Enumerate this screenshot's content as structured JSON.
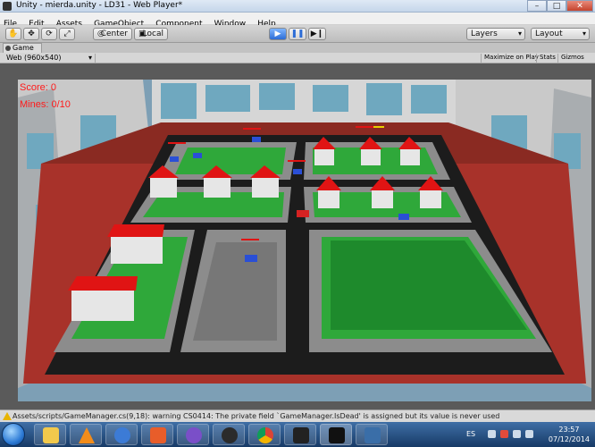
{
  "window": {
    "title": "Unity - mierda.unity - LD31 - Web Player*",
    "controls": [
      "–",
      "□",
      "✕"
    ]
  },
  "menu": [
    "File",
    "Edit",
    "Assets",
    "GameObject",
    "Component",
    "Window",
    "Help"
  ],
  "toolbar": {
    "tools": [
      "hand-icon",
      "move-icon",
      "rotate-icon",
      "scale-icon"
    ],
    "pivot": "Center",
    "space": "Local",
    "layers": "Layers",
    "layout": "Layout"
  },
  "game_tab": {
    "label": "Game",
    "resolution": "Web (960x540)",
    "maximize": "Maximize on Play",
    "stats": "Stats",
    "gizmos": "Gizmos"
  },
  "hud": {
    "score_label": "Score: 0",
    "mines_label": "Mines: 0/10"
  },
  "status": {
    "message": "Assets/scripts/GameManager.cs(9,18): warning CS0414: The private field `GameManager.IsDead' is assigned but its value is never used"
  },
  "taskbar": {
    "apps": [
      "windows-explorer",
      "vlc",
      "thunderbird",
      "media-player",
      "tor-browser",
      "winamp",
      "chrome",
      "inkscape",
      "unity",
      "unity-builder"
    ],
    "language": "ES",
    "time": "23:57",
    "date": "07/12/2014"
  },
  "colors": {
    "hud_text": "#ff1a1a",
    "road": "#1a1a1a",
    "grass": "#2fa83a",
    "roof": "#e01414",
    "wall": "#a8322a"
  }
}
